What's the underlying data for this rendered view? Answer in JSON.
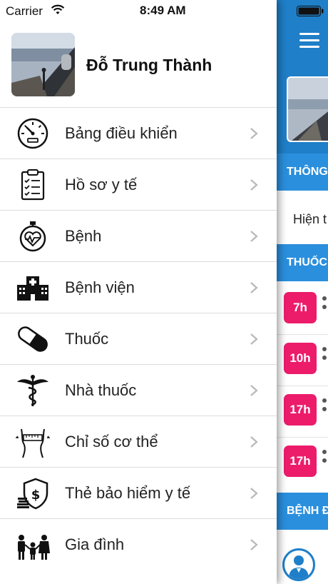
{
  "status_bar": {
    "carrier": "Carrier",
    "time": "8:49 AM"
  },
  "user": {
    "name": "Đỗ Trung Thành"
  },
  "menu": [
    {
      "label": "Bảng điều khiển",
      "icon": "dashboard-gauge-icon"
    },
    {
      "label": "Hồ sơ y tế",
      "icon": "clipboard-checklist-icon"
    },
    {
      "label": "Bệnh",
      "icon": "heart-stopwatch-icon"
    },
    {
      "label": "Bệnh viện",
      "icon": "hospital-building-icon"
    },
    {
      "label": "Thuốc",
      "icon": "pill-capsule-icon"
    },
    {
      "label": "Nhà thuốc",
      "icon": "caduceus-icon"
    },
    {
      "label": "Chỉ số cơ thể",
      "icon": "body-measure-icon"
    },
    {
      "label": "Thẻ bảo hiểm y tế",
      "icon": "insurance-shield-icon"
    },
    {
      "label": "Gia đình",
      "icon": "family-icon"
    }
  ],
  "background_screen": {
    "sections": [
      "THÔNG",
      "THUỐC",
      "BỆNH Đ"
    ],
    "row_text": "Hiện t",
    "medicine_times": [
      "7h",
      "10h",
      "17h",
      "17h"
    ]
  },
  "colors": {
    "header_blue": "#1f7fc8",
    "section_blue": "#2a8fdd",
    "time_pill": "#ec1c6b"
  }
}
